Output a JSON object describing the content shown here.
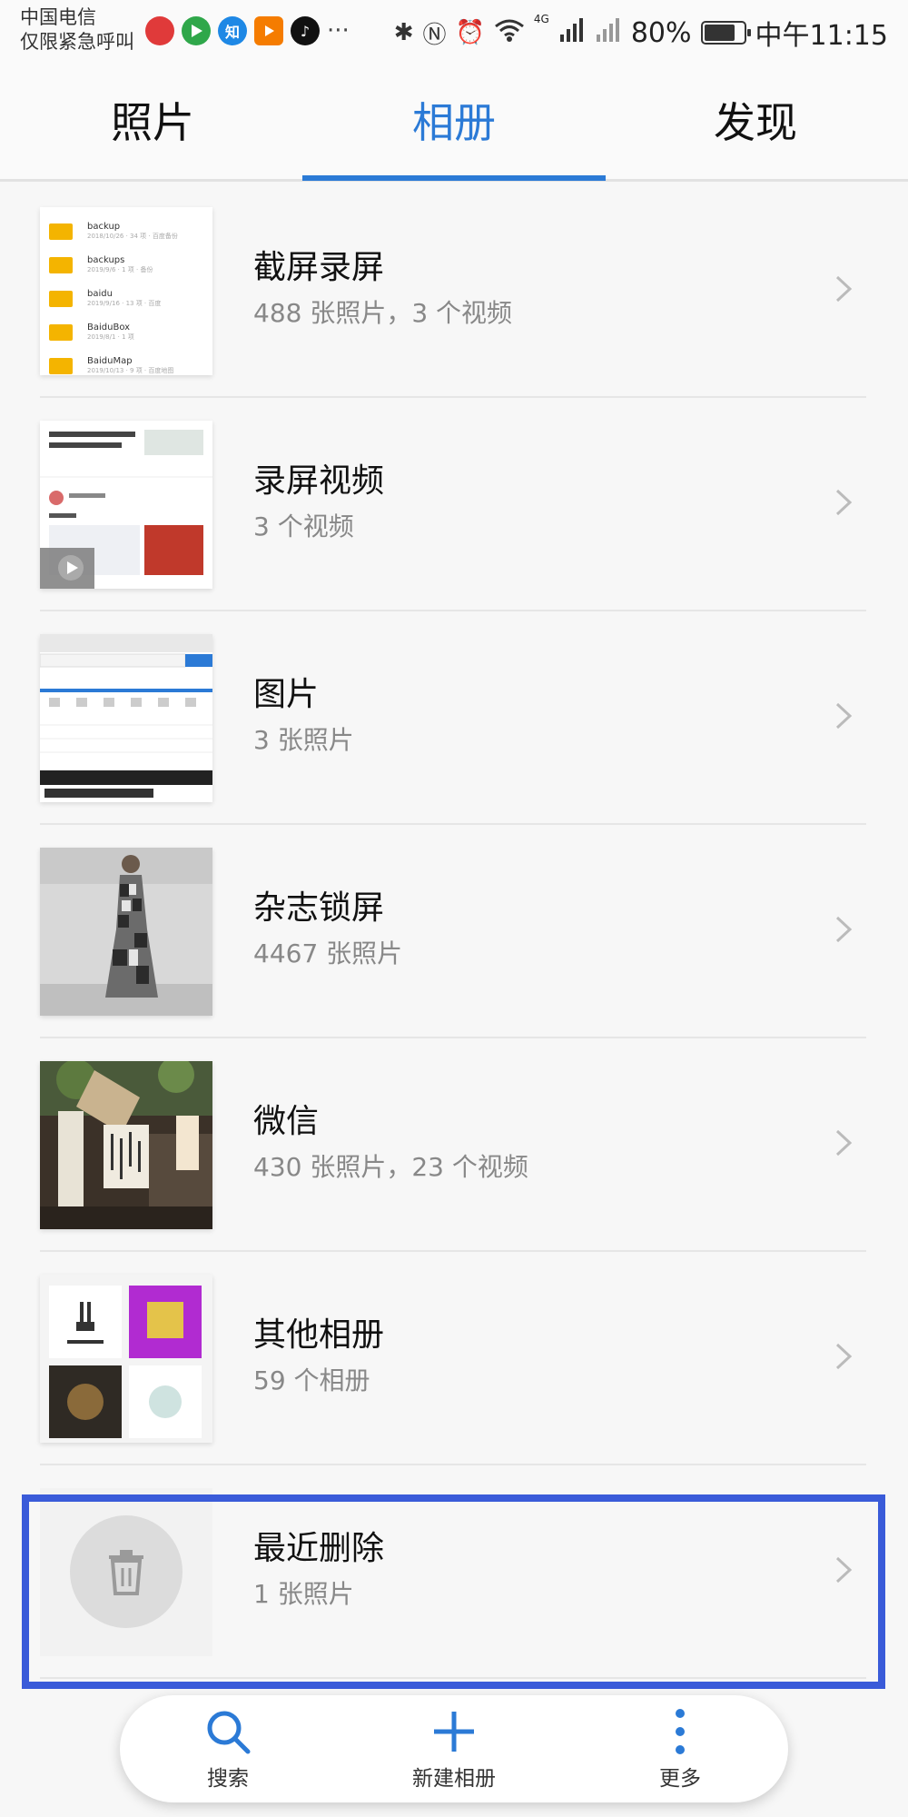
{
  "status_bar": {
    "carrier_line1": "中国电信",
    "carrier_line2": "仅限紧急呼叫",
    "app_icons": [
      "weibo-icon",
      "play-store-icon",
      "zhihu-icon",
      "video-player-icon",
      "tiktok-icon"
    ],
    "app_icon_labels": [
      "",
      "",
      "知",
      "",
      ""
    ],
    "more": "···",
    "network": "4G",
    "battery": "80%",
    "time": "中午11:15",
    "battery_level": 0.8
  },
  "tabs": [
    {
      "label": "照片",
      "active": false
    },
    {
      "label": "相册",
      "active": true
    },
    {
      "label": "发现",
      "active": false
    }
  ],
  "albums": [
    {
      "name": "截屏录屏",
      "count": "488 张照片，3 个视频",
      "thumb": "folders"
    },
    {
      "name": "录屏视频",
      "count": "3 个视频",
      "thumb": "social"
    },
    {
      "name": "图片",
      "count": "3 张照片",
      "thumb": "webpage"
    },
    {
      "name": "杂志锁屏",
      "count": "4467 张照片",
      "thumb": "fashion"
    },
    {
      "name": "微信",
      "count": "430 张照片，23 个视频",
      "thumb": "restaurant"
    },
    {
      "name": "其他相册",
      "count": "59 个相册",
      "thumb": "grid"
    },
    {
      "name": "最近删除",
      "count": "1 张照片",
      "thumb": "trash"
    }
  ],
  "folder_thumb": [
    {
      "name": "backup",
      "meta": "2018/10/26 · 34 项 · 百度备份"
    },
    {
      "name": "backups",
      "meta": "2019/9/6 · 1 项 · 备份"
    },
    {
      "name": "baidu",
      "meta": "2019/9/16 · 13 项 · 百度"
    },
    {
      "name": "BaiduBox",
      "meta": "2019/8/1 · 1 项"
    },
    {
      "name": "BaiduMap",
      "meta": "2019/10/13 · 9 项 · 百度地图"
    }
  ],
  "bottom_nav": {
    "search": "搜索",
    "new_album": "新建相册",
    "more": "更多"
  },
  "colors": {
    "accent": "#2b7ad6",
    "highlight": "#3a5bd9"
  }
}
